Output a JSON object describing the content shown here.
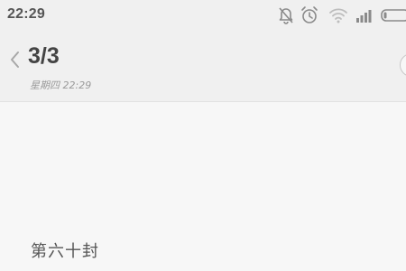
{
  "status_bar": {
    "time": "22:29",
    "icons": [
      "bell-muted-icon",
      "alarm-clock-icon",
      "wifi-icon",
      "signal-bars-icon",
      "battery-icon"
    ]
  },
  "header": {
    "title": "3/3",
    "subtitle": "星期四 22:29"
  },
  "note": {
    "text": "第六十封"
  },
  "colors": {
    "background": "#f7f7f7",
    "header_background": "#f0f0f0",
    "text_primary": "#444444",
    "text_secondary": "#9a9a9a",
    "icon": "#8a8a8a"
  }
}
